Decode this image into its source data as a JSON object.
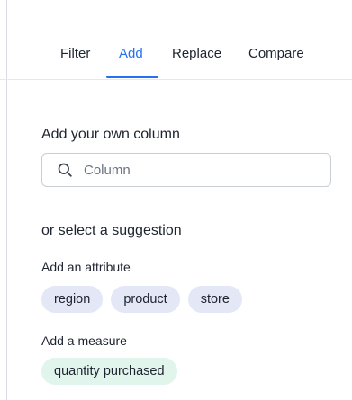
{
  "tabs": [
    {
      "label": "Filter",
      "active": false
    },
    {
      "label": "Add",
      "active": true
    },
    {
      "label": "Replace",
      "active": false
    },
    {
      "label": "Compare",
      "active": false
    }
  ],
  "add_column": {
    "title": "Add your own column",
    "search_placeholder": "Column",
    "search_icon": "search-icon"
  },
  "suggestions": {
    "title": "or select a suggestion",
    "attribute_label": "Add an attribute",
    "attributes": [
      "region",
      "product",
      "store"
    ],
    "measure_label": "Add a measure",
    "measures": [
      "quantity purchased"
    ]
  },
  "colors": {
    "accent": "#2770ef",
    "attribute_chip": "#e3e7f6",
    "measure_chip": "#e1f5ec"
  }
}
